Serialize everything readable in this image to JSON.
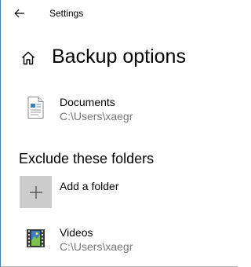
{
  "window": {
    "title": "Settings"
  },
  "page": {
    "title": "Backup options"
  },
  "included_folders": [
    {
      "name": "Documents",
      "path": "C:\\Users\\xaegr",
      "icon": "documents-icon"
    }
  ],
  "exclude": {
    "heading": "Exclude these folders",
    "add_label": "Add a folder",
    "items": [
      {
        "name": "Videos",
        "path": "C:\\Users\\xaegr",
        "icon": "videos-icon"
      }
    ]
  },
  "colors": {
    "accent_border": "#3d7ec1",
    "secondary_text": "#767676",
    "add_tile_bg": "#cccccc"
  }
}
